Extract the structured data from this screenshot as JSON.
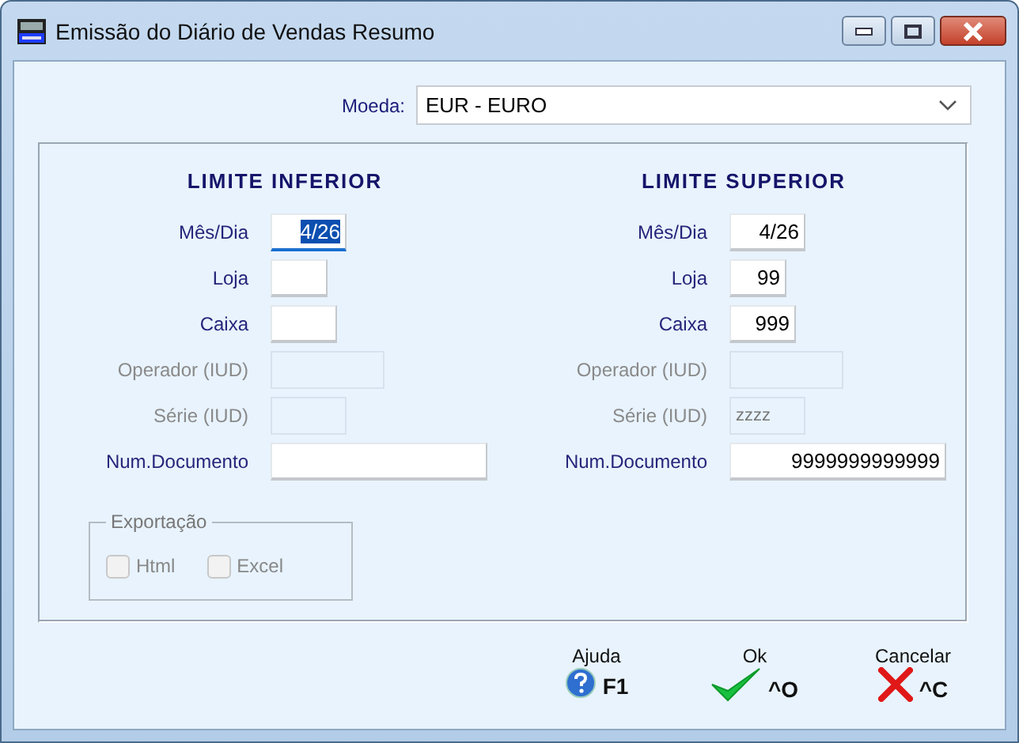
{
  "window": {
    "title": "Emissão do Diário de Vendas Resumo"
  },
  "currency": {
    "label": "Moeda:",
    "value": "EUR - EURO"
  },
  "columns": [
    {
      "title": "LIMITE INFERIOR",
      "fields": [
        {
          "label": "Mês/Dia",
          "value": "4/26",
          "disabled": false,
          "focused": true
        },
        {
          "label": "Loja",
          "disabled": false,
          "focused": false
        },
        {
          "label": "Caixa",
          "disabled": false,
          "focused": false
        },
        {
          "label": "Operador (IUD)",
          "disabled": true,
          "focused": false
        },
        {
          "label": "Série (IUD)",
          "disabled": true,
          "focused": false
        },
        {
          "label": "Num.Documento",
          "disabled": false,
          "focused": false
        }
      ]
    },
    {
      "title": "LIMITE SUPERIOR",
      "fields": [
        {
          "label": "Mês/Dia",
          "value": "4/26",
          "disabled": false,
          "focused": false
        },
        {
          "label": "Loja",
          "value": "99",
          "disabled": false,
          "focused": false
        },
        {
          "label": "Caixa",
          "value": "999",
          "disabled": false,
          "focused": false
        },
        {
          "label": "Operador (IUD)",
          "disabled": true,
          "focused": false
        },
        {
          "label": "Série (IUD)",
          "value": "zzzz",
          "disabled": true,
          "focused": false
        },
        {
          "label": "Num.Documento",
          "value": "9999999999999",
          "disabled": false,
          "focused": false
        }
      ]
    }
  ],
  "export": {
    "title": "Exportação",
    "options": [
      {
        "label": "Html",
        "checked": false,
        "disabled": true
      },
      {
        "label": "Excel",
        "checked": false,
        "disabled": true
      }
    ]
  },
  "actions": [
    {
      "kind": "help",
      "label": "Ajuda",
      "shortcut": "F1"
    },
    {
      "kind": "ok",
      "label": "Ok",
      "shortcut": "^O"
    },
    {
      "kind": "cancel",
      "label": "Cancelar",
      "shortcut": "^C"
    }
  ]
}
